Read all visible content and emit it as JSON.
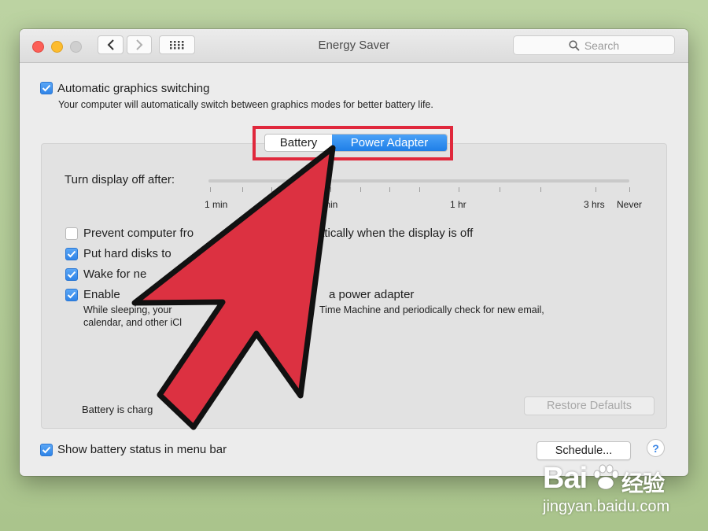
{
  "window": {
    "title": "Energy Saver",
    "search_placeholder": "Search"
  },
  "top": {
    "auto_graphics_label": "Automatic graphics switching",
    "auto_graphics_checked": true,
    "auto_graphics_desc": "Your computer will automatically switch between graphics modes for better battery life."
  },
  "tabs": {
    "battery_label": "Battery",
    "power_adapter_label": "Power Adapter",
    "selected": "Power Adapter"
  },
  "slider": {
    "label": "Turn display off after:",
    "ticks": [
      "1 min",
      "min",
      "1 hr",
      "3 hrs",
      "Never"
    ]
  },
  "options": [
    {
      "label": "Prevent computer fro",
      "label_tail": "atically when the display is off",
      "checked": false
    },
    {
      "label": "Put hard disks to",
      "label_tail": "",
      "checked": true
    },
    {
      "label": "Wake for ne",
      "label_tail": "",
      "checked": true
    },
    {
      "label": "Enable",
      "label_tail": "a power adapter",
      "checked": true
    }
  ],
  "option_desc": {
    "line1_head": "While sleeping, your ",
    "line1_tail": "Time Machine and periodically check for new email,",
    "line2": "calendar, and other iCl"
  },
  "battery_status": "Battery is charg",
  "restore_defaults_label": "Restore Defaults",
  "show_battery_label": "Show battery status in menu bar",
  "show_battery_checked": true,
  "schedule_label": "Schedule...",
  "help_label": "?",
  "watermark": {
    "brand": "Bai",
    "brand_cn": "经验",
    "url": "jingyan.baidu.com"
  },
  "colors": {
    "accent": "#2f84e8",
    "annotation_red": "#e0283c"
  }
}
